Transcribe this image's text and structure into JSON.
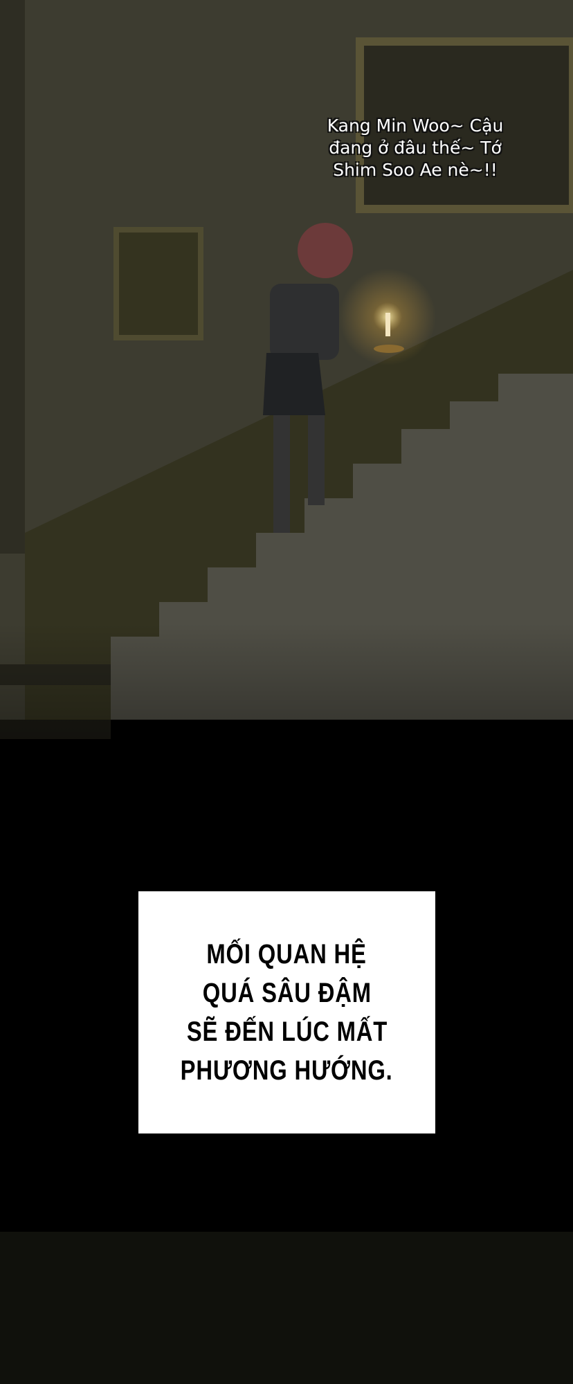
{
  "speech_bubble": {
    "lines": [
      "Kang Min Woo~ Cậu",
      "đang ở đâu thế~ Tớ",
      "Shim Soo Ae nè~!!"
    ]
  },
  "caption": {
    "lines": [
      "MỐI QUAN HỆ",
      "QUÁ SÂU ĐẬM",
      "SẼ ĐẾN LÚC MẤT",
      "PHƯƠNG HƯỚNG."
    ]
  },
  "colors": {
    "wall": "#3f3e31",
    "stairs": "#4a4836",
    "caption_bg": "#ffffff",
    "candle": "#ffd36a"
  }
}
